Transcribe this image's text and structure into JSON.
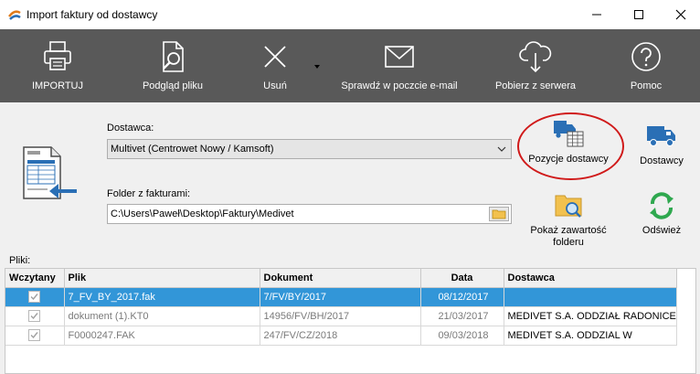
{
  "window": {
    "title": "Import faktury od dostawcy"
  },
  "toolbar": {
    "items": [
      {
        "label": "IMPORTUJ",
        "icon": "printer-icon"
      },
      {
        "label": "Podgląd pliku",
        "icon": "file-search-icon"
      },
      {
        "label": "Usuń",
        "icon": "close-icon"
      },
      {
        "label": "Sprawdź w poczcie e-mail",
        "icon": "envelope-icon"
      },
      {
        "label": "Pobierz z serwera",
        "icon": "cloud-download-icon"
      },
      {
        "label": "Pomoc",
        "icon": "help-icon"
      }
    ]
  },
  "form": {
    "supplier_label": "Dostawca:",
    "supplier_value": "Multivet (Centrowet Nowy / Kamsoft)",
    "folder_label": "Folder z fakturami:",
    "folder_value": "C:\\Users\\Paweł\\Desktop\\Faktury\\Medivet"
  },
  "side_buttons": {
    "positions": "Pozycje dostawcy",
    "suppliers": "Dostawcy",
    "show_folder_line1": "Pokaż zawartość",
    "show_folder_line2": "folderu",
    "refresh": "Odśwież"
  },
  "files": {
    "label": "Pliki:",
    "columns": [
      "Wczytany",
      "Plik",
      "Dokument",
      "Data",
      "Dostawca"
    ],
    "rows": [
      {
        "loaded": true,
        "file": "7_FV_BY_2017.fak",
        "document": "7/FV/BY/2017",
        "date": "08/12/2017",
        "supplier": ""
      },
      {
        "loaded": true,
        "file": "dokument (1).KT0",
        "document": "14956/FV/BH/2017",
        "date": "21/03/2017",
        "supplier": "MEDIVET S.A. ODDZIAŁ RADONICE"
      },
      {
        "loaded": true,
        "file": "F0000247.FAK",
        "document": "247/FV/CZ/2018",
        "date": "09/03/2018",
        "supplier": "MEDIVET S.A. ODDZIAL W"
      }
    ]
  },
  "colors": {
    "toolbar_bg": "#595959",
    "selection": "#3296d8",
    "highlight_ring": "#d01a1a",
    "accent_blue": "#2a6fb5",
    "accent_green": "#2fa84f"
  }
}
